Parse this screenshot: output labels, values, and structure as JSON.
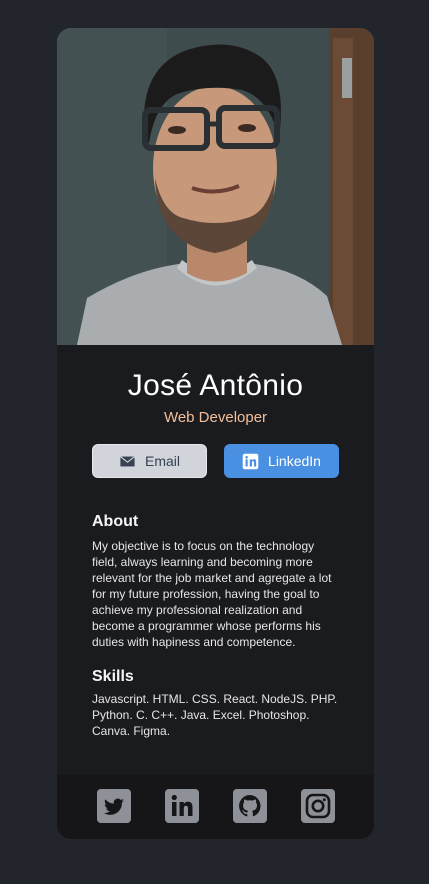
{
  "profile": {
    "name": "José Antônio",
    "role": "Web Developer"
  },
  "buttons": {
    "email_label": "Email",
    "linkedin_label": "LinkedIn"
  },
  "about": {
    "title": "About",
    "text": "My objective is to focus on the technology field, always learning and becoming more relevant for the job market and agregate a lot for my future profession, having the goal to achieve my professional realization and become a programmer whose performs his duties with hapiness and competence."
  },
  "skills": {
    "title": "Skills",
    "text": "Javascript. HTML. CSS. React. NodeJS. PHP. Python. C. C++. Java. Excel. Photoshop. Canva. Figma."
  },
  "social": {
    "icons": [
      "twitter-icon",
      "linkedin-icon",
      "github-icon",
      "instagram-icon"
    ]
  },
  "colors": {
    "page_background": "#23252c",
    "card_background": "#1a1b1f",
    "footer_background": "#161619",
    "accent_role": "#f3bf99",
    "linkedin_button": "#4a90e2",
    "email_button": "#d1d5db",
    "social_icon": "#8f9199"
  }
}
